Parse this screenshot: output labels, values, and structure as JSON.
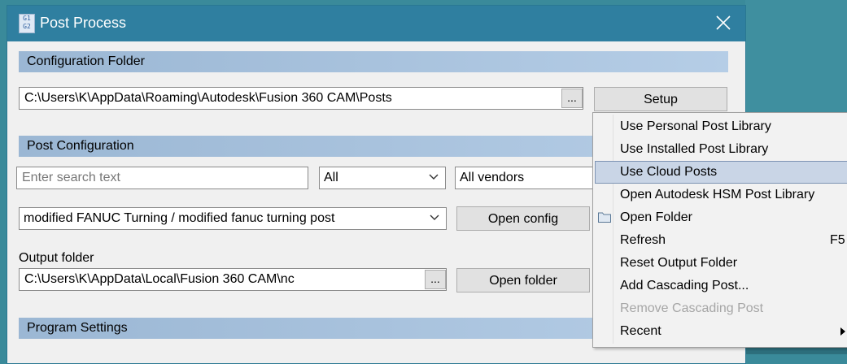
{
  "window": {
    "title": "Post Process"
  },
  "config_folder": {
    "header": "Configuration Folder",
    "path": "C:\\Users\\K\\AppData\\Roaming\\Autodesk\\Fusion 360 CAM\\Posts",
    "browse_label": "...",
    "setup_label": "Setup"
  },
  "post_config": {
    "header": "Post Configuration",
    "search_placeholder": "Enter search text",
    "filter_all": "All",
    "vendors": "All vendors",
    "post_selected": "modified FANUC Turning  / modified fanuc turning post",
    "open_config_label": "Open config"
  },
  "output": {
    "label": "Output folder",
    "path": "C:\\Users\\K\\AppData\\Local\\Fusion 360 CAM\\nc",
    "browse_label": "...",
    "open_folder_label": "Open folder"
  },
  "program_settings": {
    "header": "Program Settings"
  },
  "menu": {
    "items": [
      {
        "label": "Use Personal Post Library"
      },
      {
        "label": "Use Installed Post Library"
      },
      {
        "label": "Use Cloud Posts",
        "highlighted": true
      },
      {
        "label": "Open Autodesk HSM Post Library"
      },
      {
        "label": "Open Folder",
        "icon": "folder-icon"
      },
      {
        "label": "Refresh",
        "shortcut": "F5"
      },
      {
        "label": "Reset Output Folder"
      },
      {
        "label": "Add Cascading Post..."
      },
      {
        "label": "Remove Cascading Post",
        "disabled": true
      },
      {
        "label": "Recent",
        "submenu": true
      }
    ]
  },
  "colors": {
    "titlebar": "#2f7fa0",
    "section_header": "#b5cde6",
    "menu_highlight": "#c9d5e6"
  }
}
